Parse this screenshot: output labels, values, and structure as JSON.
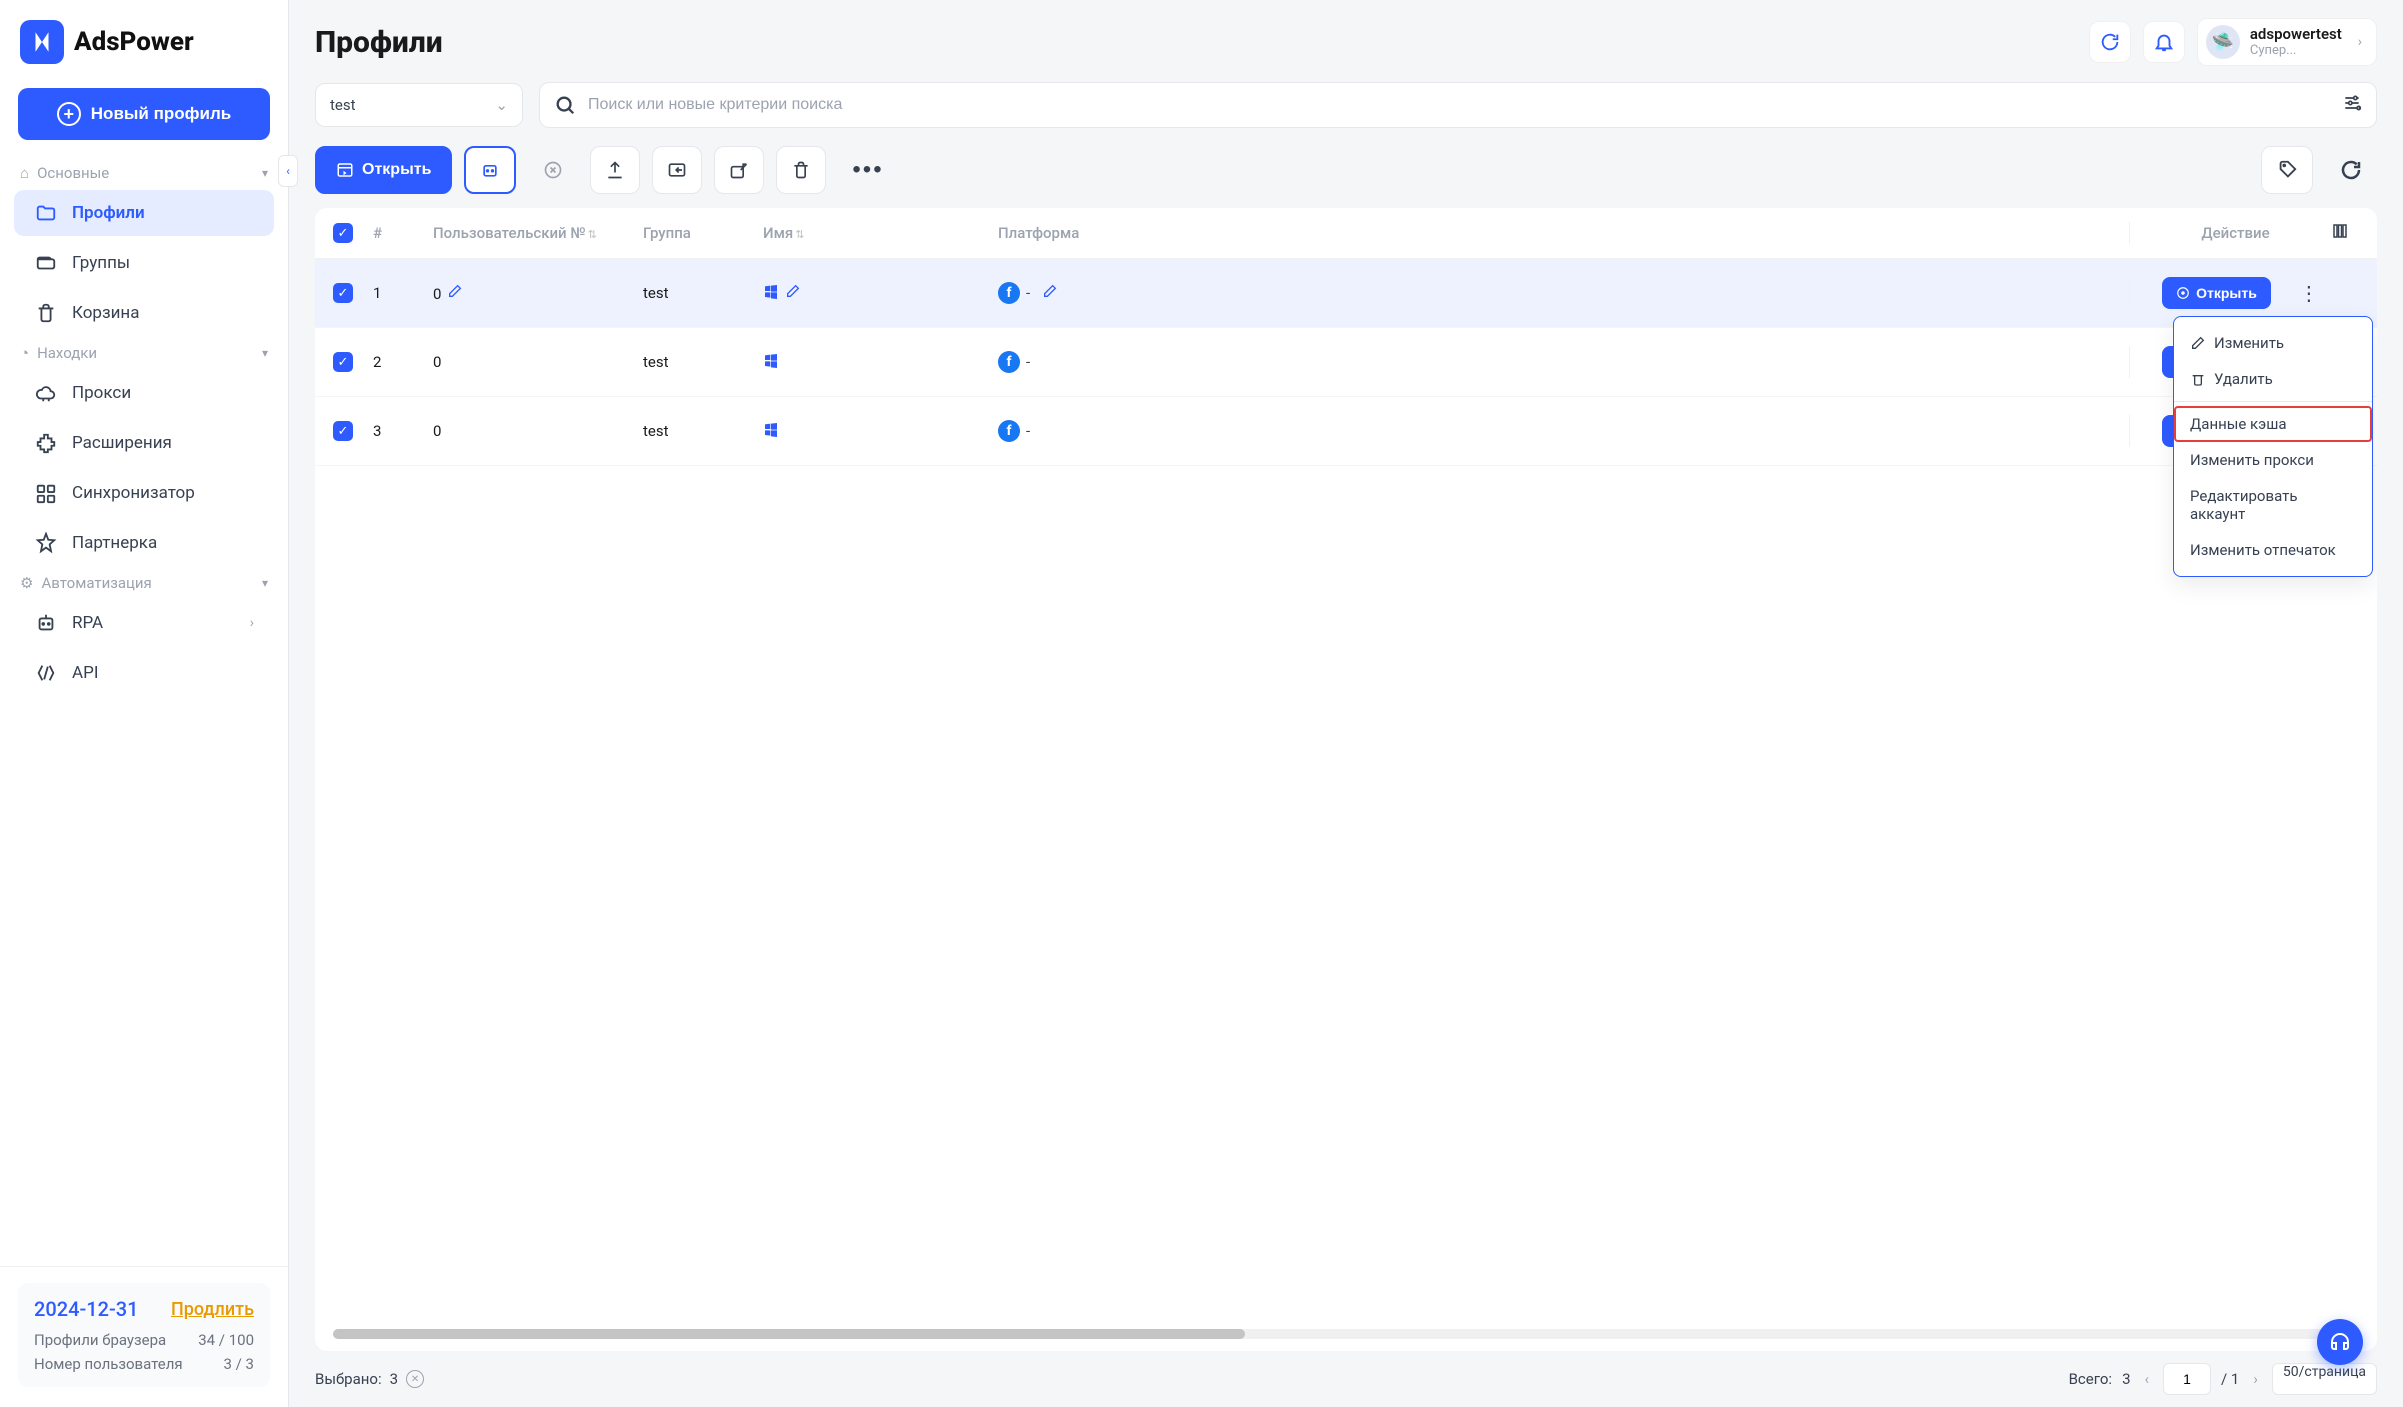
{
  "brand": "AdsPower",
  "sidebar": {
    "new_profile_btn": "Новый профиль",
    "sections": {
      "main": {
        "title": "Основные"
      },
      "finds": {
        "title": "Находки"
      },
      "automation": {
        "title": "Автоматизация"
      }
    },
    "items": {
      "profiles": "Профили",
      "groups": "Группы",
      "trash": "Корзина",
      "proxies": "Прокси",
      "extensions": "Расширения",
      "synchronizer": "Синхронизатор",
      "partner": "Партнерка",
      "rpa": "RPA",
      "api": "API"
    },
    "footer": {
      "date": "2024-12-31",
      "extend": "Продлить",
      "stat1_label": "Профили браузера",
      "stat1_value": "34 / 100",
      "stat2_label": "Номер пользователя",
      "stat2_value": "3 / 3"
    }
  },
  "page": {
    "title": "Профили",
    "user": {
      "name": "adspowertest",
      "role": "Супер..."
    },
    "group_select": "test",
    "search_placeholder": "Поиск или новые критерии поиска",
    "open_btn": "Открыть"
  },
  "table": {
    "headers": {
      "num": "#",
      "user_no": "Пользовательский №",
      "group": "Группа",
      "name": "Имя",
      "platform": "Платформа",
      "action": "Действие"
    },
    "rows": [
      {
        "num": "1",
        "user_no": "0",
        "group": "test",
        "platform_text": "-",
        "checked": true,
        "highlighted": true,
        "show_edit": true
      },
      {
        "num": "2",
        "user_no": "0",
        "group": "test",
        "platform_text": "-",
        "checked": true,
        "highlighted": false,
        "show_edit": false
      },
      {
        "num": "3",
        "user_no": "0",
        "group": "test",
        "platform_text": "-",
        "checked": true,
        "highlighted": false,
        "show_edit": false
      }
    ],
    "row_action": "Открыть"
  },
  "context_menu": {
    "edit": "Изменить",
    "delete": "Удалить",
    "cache_data": "Данные кэша",
    "change_proxy": "Изменить прокси",
    "edit_account": "Редактировать аккаунт",
    "change_fingerprint": "Изменить отпечаток"
  },
  "footer": {
    "selected_label": "Выбрано:",
    "selected_count": "3",
    "total_label": "Всего:",
    "total_count": "3",
    "page_current": "1",
    "page_total": "/ 1",
    "page_size": "50/страница"
  }
}
